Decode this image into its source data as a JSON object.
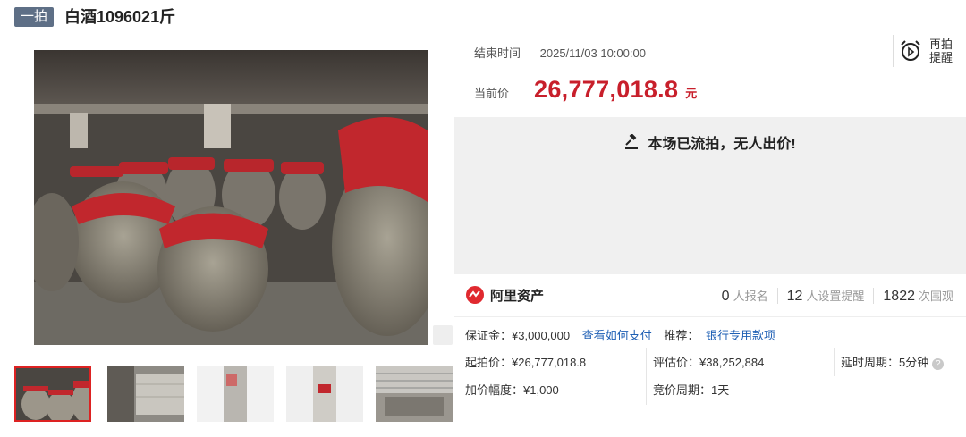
{
  "header": {
    "badge": "一拍",
    "title": "白酒1096021斤"
  },
  "auction": {
    "end_label": "结束时间",
    "end_time": "2025/11/03 10:00:00",
    "price_label": "当前价",
    "price": "26,777,018.8",
    "unit": "元",
    "remind_line1": "再拍",
    "remind_line2": "提醒",
    "status": "本场已流拍，无人出价!"
  },
  "platform": {
    "name": "阿里资产"
  },
  "stats": [
    {
      "num": "0",
      "label": "人报名"
    },
    {
      "num": "12",
      "label": "人设置提醒"
    },
    {
      "num": "1822",
      "label": "次围观"
    }
  ],
  "details": {
    "deposit": "保证金：¥3,000,000",
    "how_to_pay": "查看如何支付",
    "recommend_label": "推荐：",
    "recommend_link": "银行专用款项",
    "start_price": "起拍价：¥26,777,018.8",
    "eval_price": "评估价：¥38,252,884",
    "delay": "延时周期：5分钟",
    "increment": "加价幅度：¥1,000",
    "bid_cycle": "竞价周期：1天"
  },
  "colors": {
    "accent": "#c81f2b",
    "link": "#1e5fb4",
    "badge": "#5e6f86"
  },
  "icons": [
    "zoom-icon",
    "alarm-clock-icon",
    "gavel-icon",
    "aliasset-logo-icon",
    "help-icon"
  ]
}
